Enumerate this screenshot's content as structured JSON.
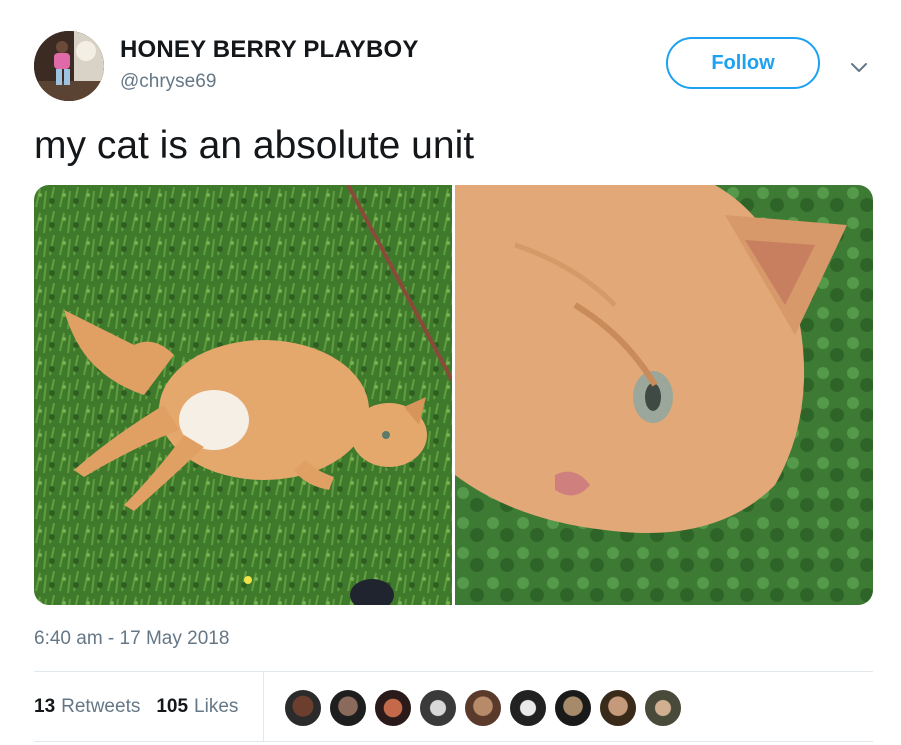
{
  "author": {
    "display_name": "HONEY BERRY PLAYBOY",
    "handle": "@chryse69"
  },
  "follow_label": "Follow",
  "tweet": {
    "text": "my cat is an absolute unit",
    "timestamp": "6:40 am - 17 May 2018"
  },
  "stats": {
    "retweets_count": "13",
    "retweets_label": "Retweets",
    "likes_count": "105",
    "likes_label": "Likes"
  },
  "icons": {
    "caret": "chevron-down-icon"
  },
  "colors": {
    "accent": "#1da1f2",
    "text_primary": "#14171a",
    "text_secondary": "#657786",
    "divider": "#e1e8ed"
  },
  "liker_count": 9
}
